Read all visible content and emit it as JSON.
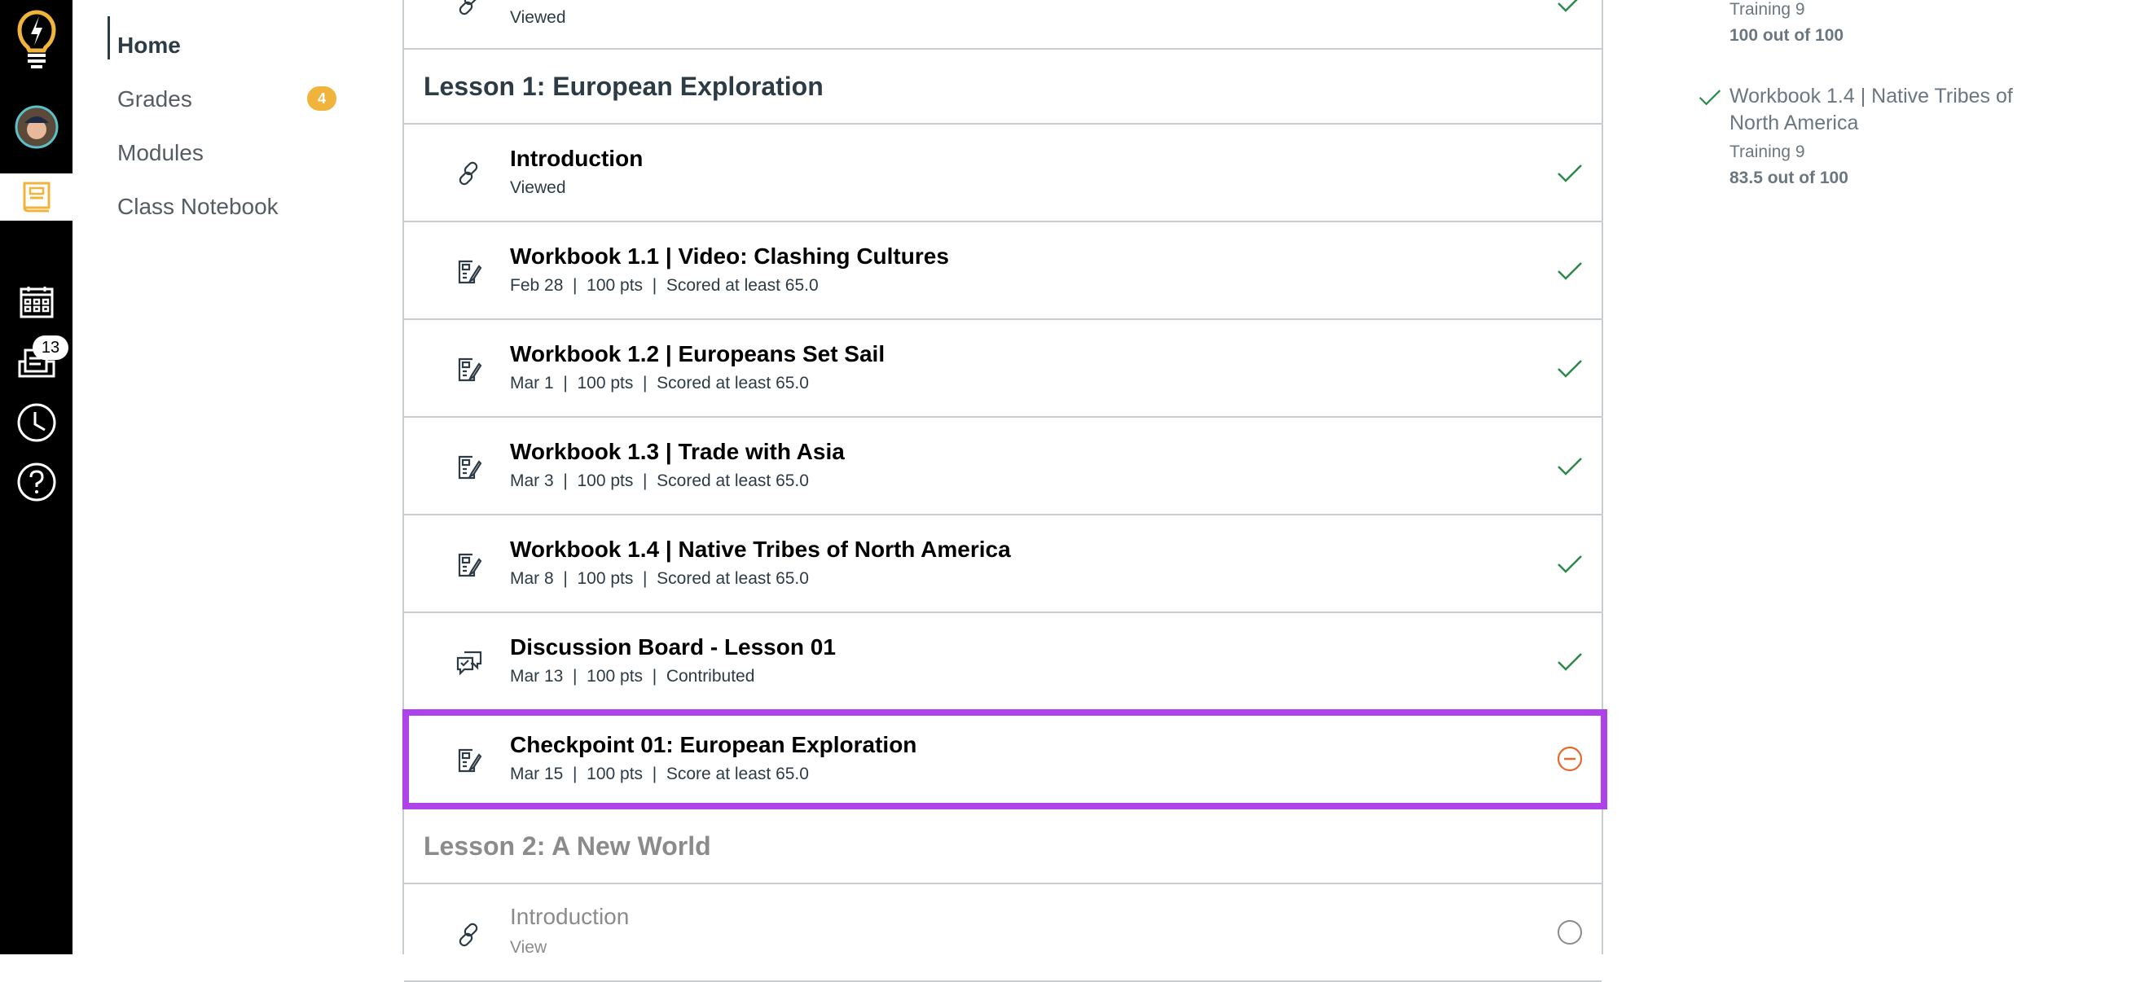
{
  "global_nav": {
    "inbox_badge": "13",
    "items": [
      "logo",
      "account",
      "dashboard",
      "courses",
      "calendar",
      "inbox",
      "history",
      "help"
    ]
  },
  "course_nav": {
    "items": [
      {
        "label": "Home",
        "active": true
      },
      {
        "label": "Grades",
        "badge": "4"
      },
      {
        "label": "Modules"
      },
      {
        "label": "Class Notebook"
      }
    ]
  },
  "modules": {
    "top_partial": {
      "sub": "Viewed",
      "status": "complete"
    },
    "lesson1": {
      "title": "Lesson 1: European Exploration",
      "items": [
        {
          "title": "Introduction",
          "sub": "Viewed",
          "icon": "link-icon",
          "status": "complete"
        },
        {
          "title": "Workbook 1.1 | Video: Clashing Cultures",
          "sub": "Feb 28  |  100 pts  |  Scored at least 65.0",
          "icon": "assignment-icon",
          "status": "complete"
        },
        {
          "title": "Workbook 1.2 | Europeans Set Sail",
          "sub": "Mar 1  |  100 pts  |  Scored at least 65.0",
          "icon": "assignment-icon",
          "status": "complete"
        },
        {
          "title": "Workbook 1.3 | Trade with Asia",
          "sub": "Mar 3  |  100 pts  |  Scored at least 65.0",
          "icon": "assignment-icon",
          "status": "complete"
        },
        {
          "title": "Workbook 1.4 | Native Tribes of North America",
          "sub": "Mar 8  |  100 pts  |  Scored at least 65.0",
          "icon": "assignment-icon",
          "status": "complete"
        },
        {
          "title": "Discussion Board - Lesson 01",
          "sub": "Mar 13  |  100 pts  |  Contributed",
          "icon": "discussion-icon",
          "status": "complete"
        },
        {
          "title": "Checkpoint 01: European Exploration",
          "sub": "Mar 15  |  100 pts  |  Score at least 65.0",
          "icon": "assignment-icon",
          "status": "incomplete",
          "highlighted": true
        }
      ]
    },
    "lesson2": {
      "title": "Lesson 2: A New World",
      "items": [
        {
          "title": "Introduction",
          "sub": "View",
          "icon": "link-icon",
          "status": "not-started"
        }
      ]
    }
  },
  "recent_feedback": {
    "items": [
      {
        "course": "Training 9",
        "score": "100 out of 100"
      },
      {
        "title": "Workbook 1.4 | Native Tribes of North America",
        "course": "Training 9",
        "score": "83.5 out of 100"
      }
    ]
  },
  "colors": {
    "accent": "#f0b33c",
    "highlight": "#ad43e8",
    "complete": "#2a8a4a",
    "incomplete": "#e66a2c"
  }
}
